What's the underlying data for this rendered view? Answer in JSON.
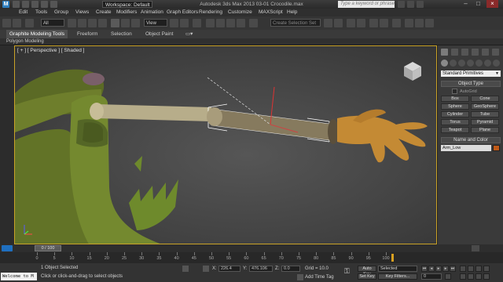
{
  "window": {
    "title": "Autodesk 3ds Max 2013     03-01 Crocodile.max",
    "workspace": "Workspace: Default",
    "search_placeholder": "Type a keyword or phrase"
  },
  "menu": [
    "Edit",
    "Tools",
    "Group",
    "Views",
    "Create",
    "Modifiers",
    "Animation",
    "Graph Editors",
    "Rendering",
    "Customize",
    "MAXScript",
    "Help"
  ],
  "toolbar": {
    "selection_filter": "All",
    "ref_coord": "View",
    "named_selection": "Create Selection Set"
  },
  "ribbon": {
    "tabs": [
      "Graphite Modeling Tools",
      "Freeform",
      "Selection",
      "Object Paint"
    ],
    "subtab": "Polygon Modeling"
  },
  "viewport": {
    "label": "[ + ] [ Perspective ] [ Shaded ]"
  },
  "command_panel": {
    "dropdown": "Standard Primitives",
    "object_type_title": "Object Type",
    "autogrid": "AutoGrid",
    "buttons": [
      "Box",
      "Cone",
      "Sphere",
      "GeoSphere",
      "Cylinder",
      "Tube",
      "Torus",
      "Pyramid",
      "Teapot",
      "Plane"
    ],
    "name_color_title": "Name and Color",
    "object_name": "Arm_Low"
  },
  "timeline": {
    "frame": "0 / 100",
    "ticks": [
      "0",
      "5",
      "10",
      "15",
      "20",
      "25",
      "30",
      "35",
      "40",
      "45",
      "50",
      "55",
      "60",
      "65",
      "70",
      "75",
      "80",
      "85",
      "90",
      "95",
      "100"
    ]
  },
  "status": {
    "maxscript": "Welcome to M",
    "selected": "1 Object Selected",
    "prompt": "Click or click-and-drag to select objects",
    "x_label": "X:",
    "x_value": "226.4",
    "y_label": "Y:",
    "y_value": "476.106",
    "z_label": "Z:",
    "z_value": "0.0",
    "grid": "Grid = 10.0",
    "add_time_tag": "Add Time Tag",
    "auto_key": "Auto Key",
    "set_key": "Set Key",
    "key_mode": "Selected",
    "key_filters": "Key Filters...",
    "current_frame": "0"
  }
}
